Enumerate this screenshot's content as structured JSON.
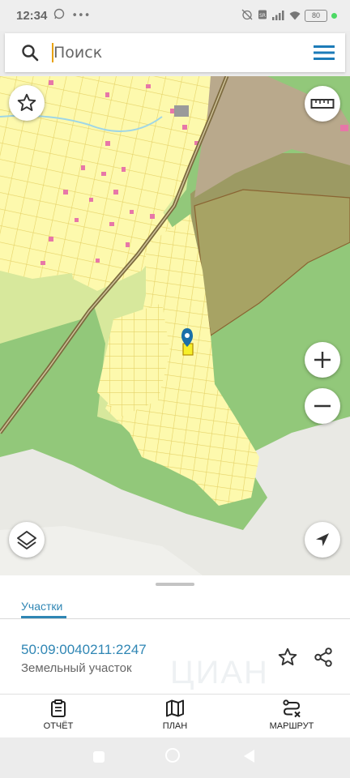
{
  "status": {
    "time": "12:34",
    "battery": "80"
  },
  "search": {
    "placeholder": "Поиск"
  },
  "tabs": [
    {
      "label": "Участки"
    }
  ],
  "parcel": {
    "number": "50:09:0040211:2247",
    "type": "Земельный участок"
  },
  "watermark": "ЦИАН",
  "actions": [
    {
      "label": "ОТЧЁТ",
      "icon": "clipboard-icon"
    },
    {
      "label": "ПЛАН",
      "icon": "map-icon"
    },
    {
      "label": "МАРШРУТ",
      "icon": "route-icon"
    }
  ],
  "colors": {
    "accent": "#2f86b4",
    "map_green": "#92c87a",
    "map_dark_green": "#a5a35c",
    "map_yellow": "#fdf9ad",
    "pin": "#1a6fa8"
  }
}
